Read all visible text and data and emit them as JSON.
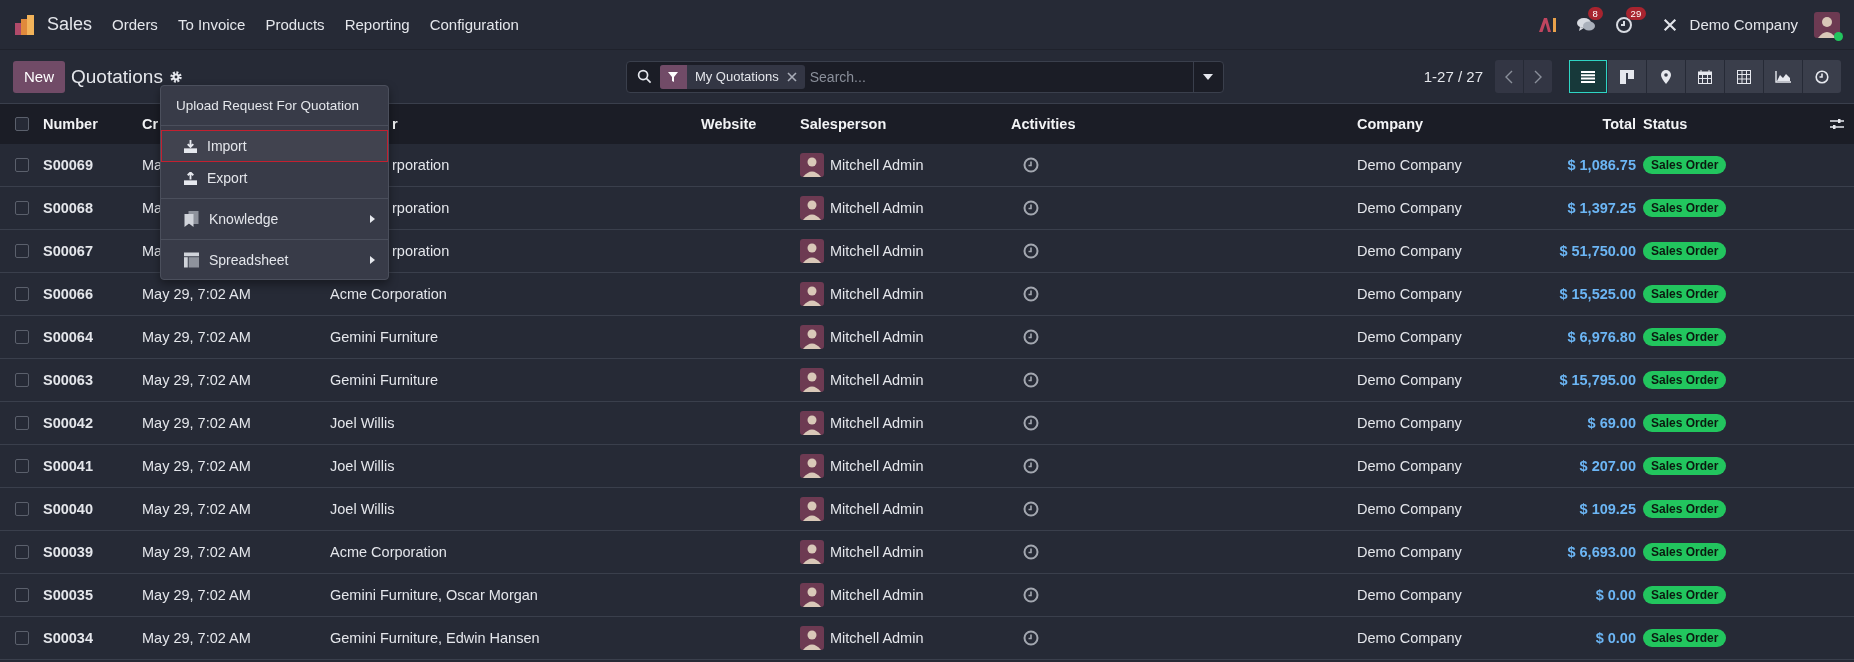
{
  "navbar": {
    "app": "Sales",
    "menus": [
      "Orders",
      "To Invoice",
      "Products",
      "Reporting",
      "Configuration"
    ],
    "chat_count": "8",
    "activity_count": "29",
    "company": "Demo Company",
    "online": true
  },
  "control_panel": {
    "new_button": "New",
    "title": "Quotations",
    "search": {
      "facet": "My Quotations",
      "placeholder": "Search..."
    },
    "pager": "1-27 / 27",
    "views": [
      {
        "kind": "list",
        "selected": true
      },
      {
        "kind": "kanban",
        "selected": false
      },
      {
        "kind": "map",
        "selected": false
      },
      {
        "kind": "calendar",
        "selected": false
      },
      {
        "kind": "pivot",
        "selected": false
      },
      {
        "kind": "graph",
        "selected": false
      },
      {
        "kind": "activity",
        "selected": false
      }
    ]
  },
  "action_menu": {
    "sections": [
      [
        {
          "kind": "plain",
          "label": "Upload Request For Quotation",
          "selected": false
        }
      ],
      [
        {
          "kind": "import",
          "label": "Import",
          "selected": true
        },
        {
          "kind": "export",
          "label": "Export",
          "selected": false
        }
      ],
      [
        {
          "kind": "knowledge",
          "label": "Knowledge",
          "selected": false
        }
      ],
      [
        {
          "kind": "spreadsheet",
          "label": "Spreadsheet",
          "selected": false
        }
      ]
    ]
  },
  "table": {
    "header_checked": false,
    "columns": [
      {
        "label": "Number",
        "covered": false
      },
      {
        "label": "Cr",
        "covered": false
      },
      {
        "label": "r",
        "covered": true
      },
      {
        "label": "Website",
        "covered": false
      },
      {
        "label": "Salesperson",
        "covered": false
      },
      {
        "label": "Activities",
        "covered": false
      },
      {
        "label": "Company",
        "covered": false
      },
      {
        "label": "Total",
        "covered": false
      },
      {
        "label": "Status",
        "covered": false
      }
    ],
    "rows": [
      {
        "number": "S00069",
        "created": "Ma",
        "customer": "rporation",
        "customer_covered": true,
        "salesperson": "Mitchell Admin",
        "company": "Demo Company",
        "total": "$ 1,086.75",
        "status": "Sales Order",
        "checked": false
      },
      {
        "number": "S00068",
        "created": "Ma",
        "customer": "rporation",
        "customer_covered": true,
        "salesperson": "Mitchell Admin",
        "company": "Demo Company",
        "total": "$ 1,397.25",
        "status": "Sales Order",
        "checked": false
      },
      {
        "number": "S00067",
        "created": "Ma",
        "customer": "rporation",
        "customer_covered": true,
        "salesperson": "Mitchell Admin",
        "company": "Demo Company",
        "total": "$ 51,750.00",
        "status": "Sales Order",
        "checked": false
      },
      {
        "number": "S00066",
        "created": "May 29, 7:02 AM",
        "customer": "Acme Corporation",
        "customer_covered": false,
        "salesperson": "Mitchell Admin",
        "company": "Demo Company",
        "total": "$ 15,525.00",
        "status": "Sales Order",
        "checked": false
      },
      {
        "number": "S00064",
        "created": "May 29, 7:02 AM",
        "customer": "Gemini Furniture",
        "customer_covered": false,
        "salesperson": "Mitchell Admin",
        "company": "Demo Company",
        "total": "$ 6,976.80",
        "status": "Sales Order",
        "checked": false
      },
      {
        "number": "S00063",
        "created": "May 29, 7:02 AM",
        "customer": "Gemini Furniture",
        "customer_covered": false,
        "salesperson": "Mitchell Admin",
        "company": "Demo Company",
        "total": "$ 15,795.00",
        "status": "Sales Order",
        "checked": false
      },
      {
        "number": "S00042",
        "created": "May 29, 7:02 AM",
        "customer": "Joel Willis",
        "customer_covered": false,
        "salesperson": "Mitchell Admin",
        "company": "Demo Company",
        "total": "$ 69.00",
        "status": "Sales Order",
        "checked": false
      },
      {
        "number": "S00041",
        "created": "May 29, 7:02 AM",
        "customer": "Joel Willis",
        "customer_covered": false,
        "salesperson": "Mitchell Admin",
        "company": "Demo Company",
        "total": "$ 207.00",
        "status": "Sales Order",
        "checked": false
      },
      {
        "number": "S00040",
        "created": "May 29, 7:02 AM",
        "customer": "Joel Willis",
        "customer_covered": false,
        "salesperson": "Mitchell Admin",
        "company": "Demo Company",
        "total": "$ 109.25",
        "status": "Sales Order",
        "checked": false
      },
      {
        "number": "S00039",
        "created": "May 29, 7:02 AM",
        "customer": "Acme Corporation",
        "customer_covered": false,
        "salesperson": "Mitchell Admin",
        "company": "Demo Company",
        "total": "$ 6,693.00",
        "status": "Sales Order",
        "checked": false
      },
      {
        "number": "S00035",
        "created": "May 29, 7:02 AM",
        "customer": "Gemini Furniture, Oscar Morgan",
        "customer_covered": false,
        "salesperson": "Mitchell Admin",
        "company": "Demo Company",
        "total": "$ 0.00",
        "status": "Sales Order",
        "checked": false
      },
      {
        "number": "S00034",
        "created": "May 29, 7:02 AM",
        "customer": "Gemini Furniture, Edwin Hansen",
        "customer_covered": false,
        "salesperson": "Mitchell Admin",
        "company": "Demo Company",
        "total": "$ 0.00",
        "status": "Sales Order",
        "checked": false
      }
    ]
  }
}
